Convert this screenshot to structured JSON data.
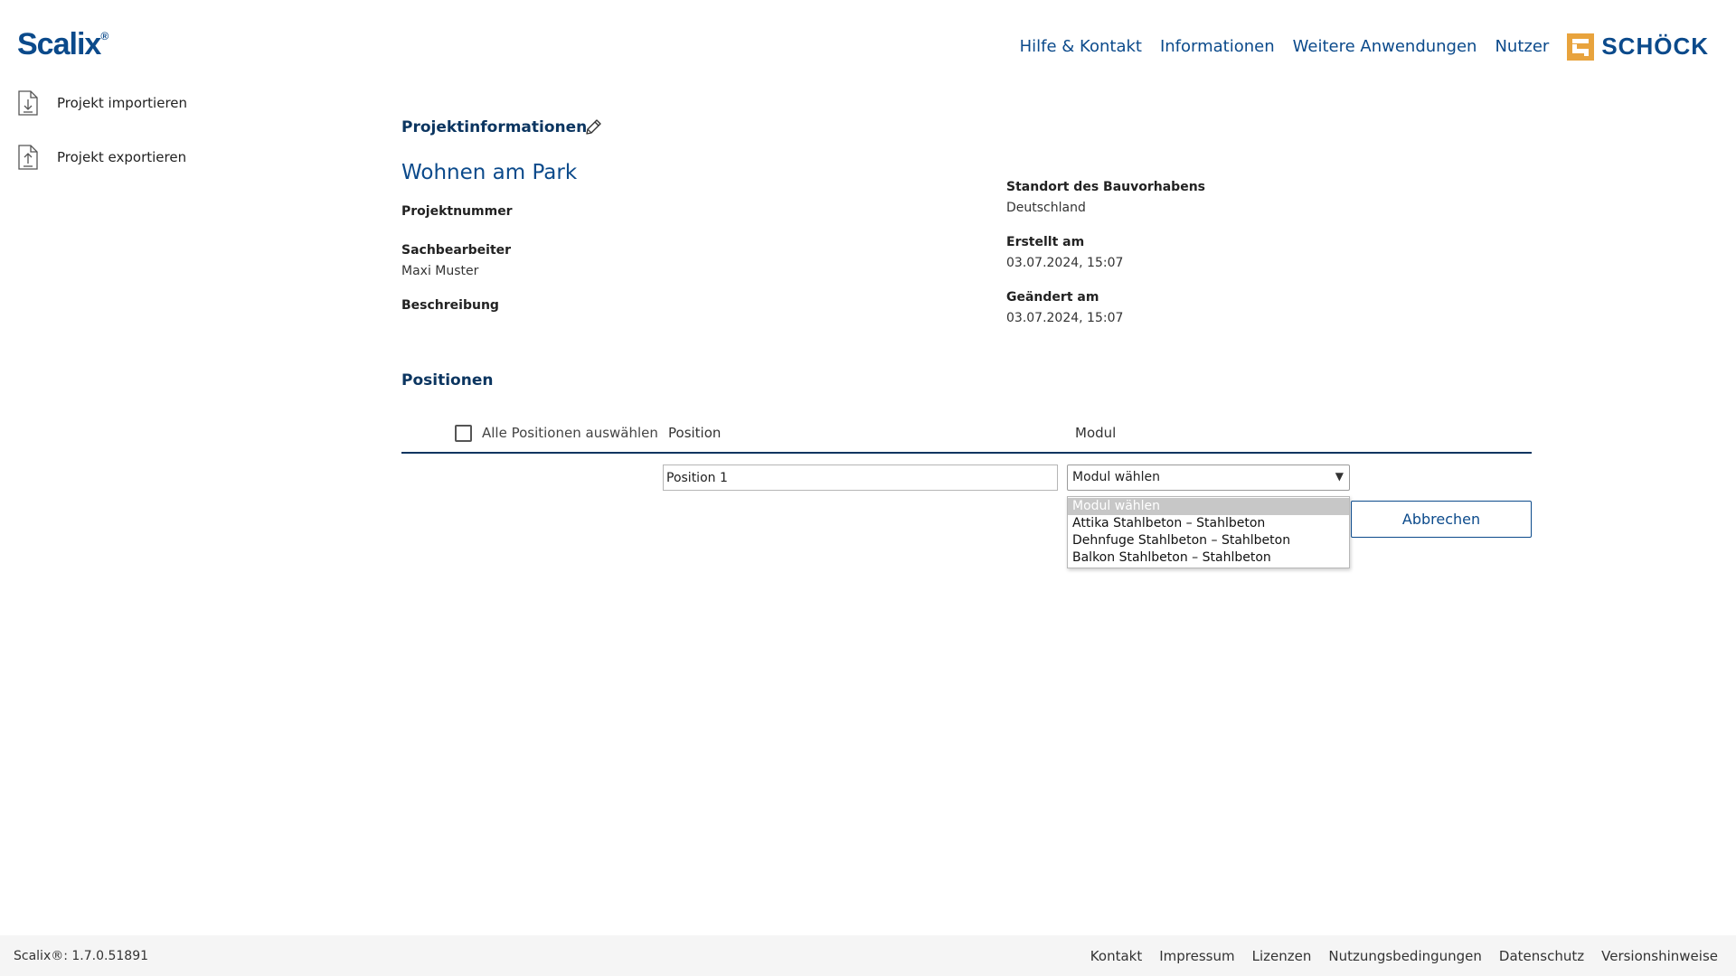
{
  "app": {
    "brand": "Scalix",
    "brand_mark": "®"
  },
  "header": {
    "nav": [
      "Hilfe & Kontakt",
      "Informationen",
      "Weitere Anwendungen",
      "Nutzer"
    ],
    "logo_text": "SCHÖCK"
  },
  "sidebar": {
    "items": [
      {
        "label": "Projekt importieren",
        "icon": "file-import-icon"
      },
      {
        "label": "Projekt exportieren",
        "icon": "file-export-icon"
      }
    ]
  },
  "project": {
    "section_title": "Projektinformationen",
    "name": "Wohnen am Park",
    "fields_left": [
      {
        "label": "Projektnummer",
        "value": ""
      },
      {
        "label": "Sachbearbeiter",
        "value": "Maxi Muster"
      },
      {
        "label": "Beschreibung",
        "value": ""
      }
    ],
    "fields_right": [
      {
        "label": "Standort des Bauvorhabens",
        "value": "Deutschland"
      },
      {
        "label": "Erstellt am",
        "value": "03.07.2024, 15:07"
      },
      {
        "label": "Geändert am",
        "value": "03.07.2024, 15:07"
      }
    ]
  },
  "positions": {
    "title": "Positionen",
    "select_all_label": "Alle Positionen auswählen",
    "columns": [
      "Position",
      "Modul"
    ],
    "row": {
      "position_value": "Position 1",
      "module_selected": "Modul wählen"
    },
    "module_options": [
      "Modul wählen",
      "Attika Stahlbeton – Stahlbeton",
      "Dehnfuge Stahlbeton – Stahlbeton",
      "Balkon Stahlbeton – Stahlbeton"
    ],
    "cancel_label": "Abbrechen"
  },
  "footer": {
    "version": "Scalix®: 1.7.0.51891",
    "links": [
      "Kontakt",
      "Impressum",
      "Lizenzen",
      "Nutzungsbedingungen",
      "Datenschutz",
      "Versionshinweise"
    ]
  },
  "colors": {
    "primary": "#0b4a8b",
    "dark_blue": "#0b3560",
    "logo_orange": "#e8a33d",
    "footer_bg": "#f5f5f5"
  }
}
